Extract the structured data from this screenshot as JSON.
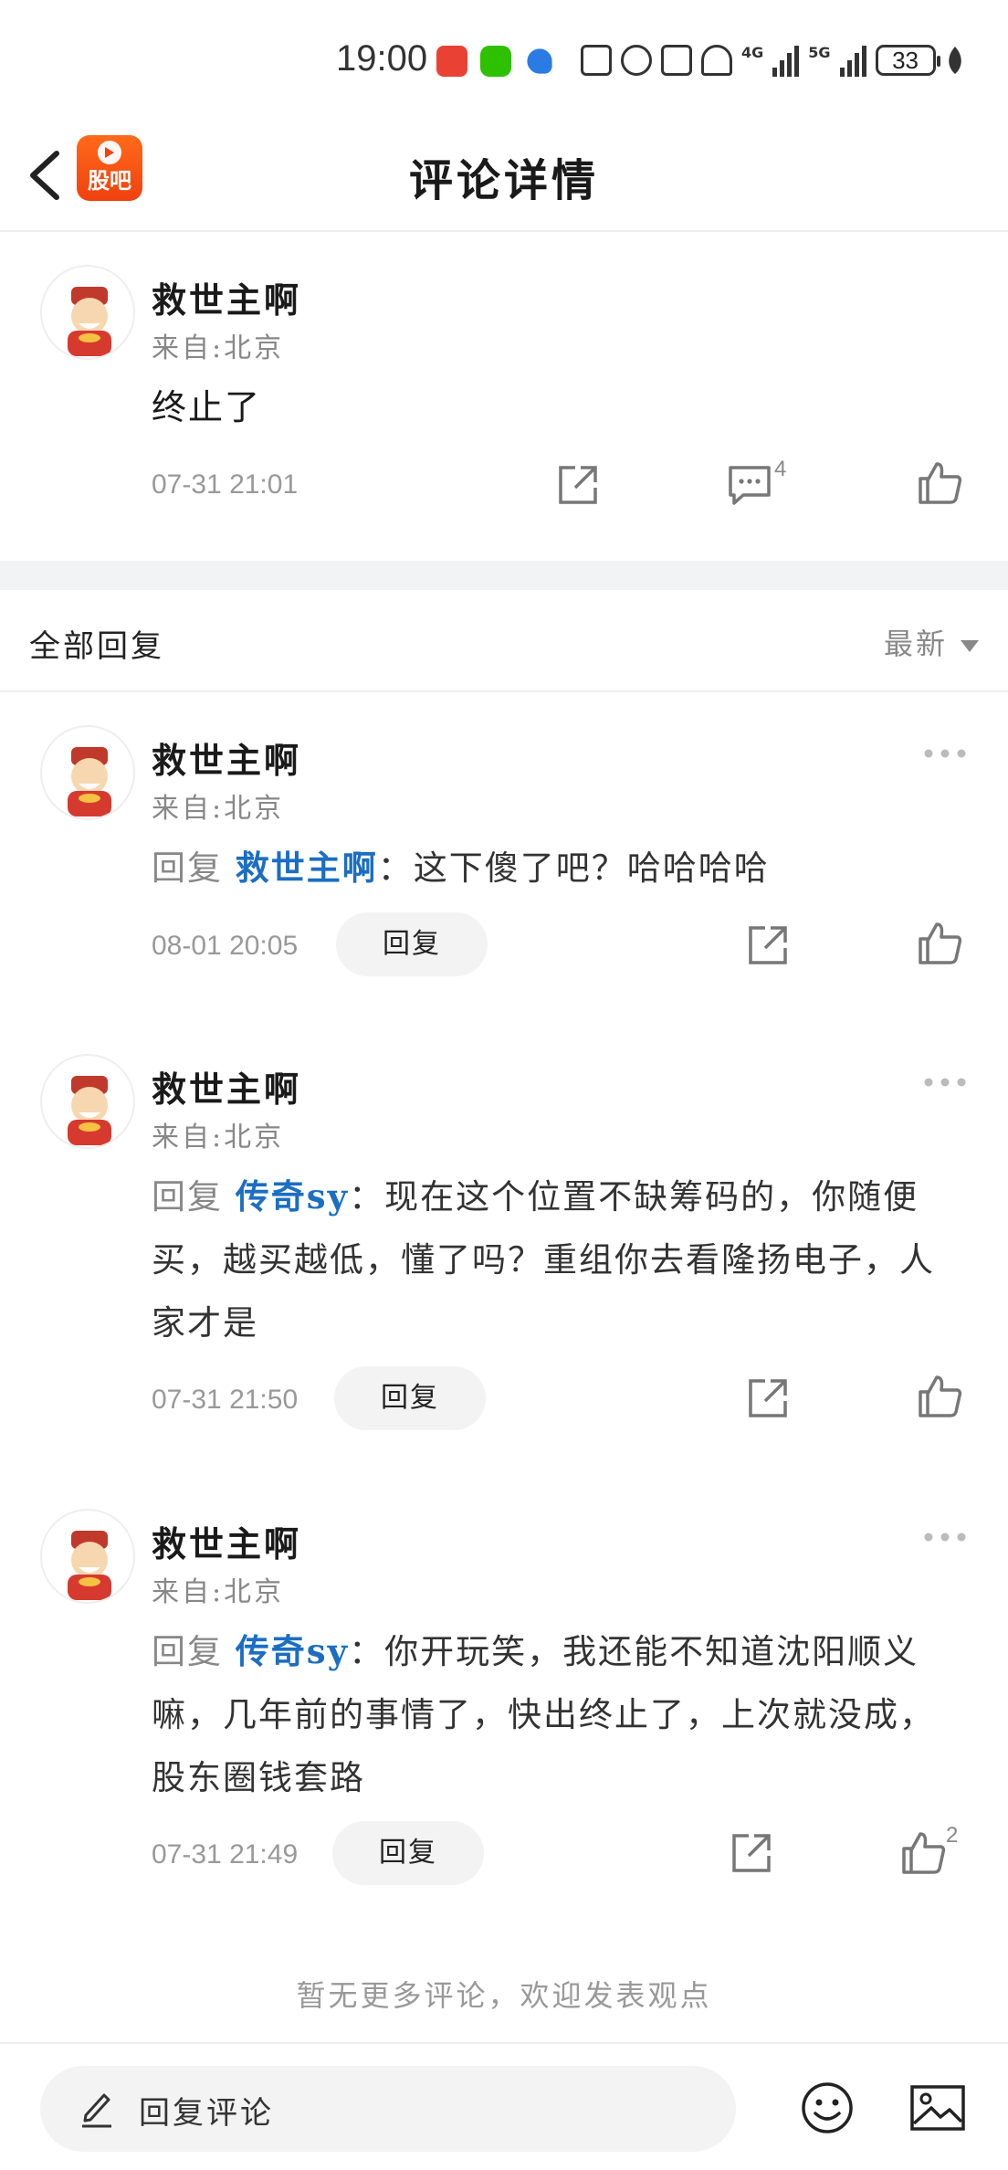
{
  "status_bar": {
    "time": "19:00",
    "network_1": "4G",
    "network_2": "5G",
    "battery": "33"
  },
  "header": {
    "title": "评论详情",
    "logo_text": "股吧"
  },
  "main_post": {
    "username": "救世主啊",
    "location": "来自:北京",
    "content": "终止了",
    "time": "07-31 21:01",
    "comment_count": "4"
  },
  "section": {
    "title": "全部回复",
    "sort_label": "最新"
  },
  "replies": [
    {
      "username": "救世主啊",
      "location": "来自:北京",
      "reply_prefix": "回复",
      "reply_to": "救世主啊",
      "text": "：这下傻了吧？哈哈哈哈",
      "time": "08-01 20:05",
      "reply_label": "回复",
      "like_count": ""
    },
    {
      "username": "救世主啊",
      "location": "来自:北京",
      "reply_prefix": "回复",
      "reply_to": "传奇sy",
      "text": "：现在这个位置不缺筹码的，你随便买，越买越低，懂了吗？重组你去看隆扬电子，人家才是",
      "time": "07-31 21:50",
      "reply_label": "回复",
      "like_count": ""
    },
    {
      "username": "救世主啊",
      "location": "来自:北京",
      "reply_prefix": "回复",
      "reply_to": "传奇sy",
      "text": "：你开玩笑，我还能不知道沈阳顺义嘛，几年前的事情了，快出终止了，上次就没成，股东圈钱套路",
      "time": "07-31 21:49",
      "reply_label": "回复",
      "like_count": "2"
    }
  ],
  "footer_note": "暂无更多评论，欢迎发表观点",
  "bottom_bar": {
    "input_placeholder": "回复评论"
  },
  "colors": {
    "accent_blue": "#1b6ec2",
    "brand_orange": "#f0410f",
    "divider": "#f2f3f5"
  }
}
